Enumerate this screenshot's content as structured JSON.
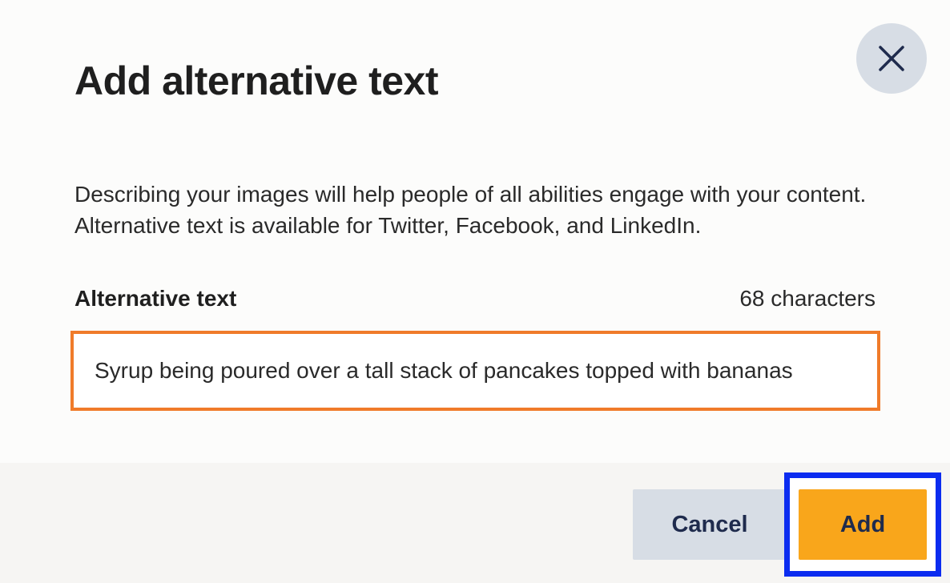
{
  "dialog": {
    "title": "Add alternative text",
    "description": "Describing your images will help people of all abilities engage with your content. Alternative text is available for Twitter, Facebook, and LinkedIn.",
    "close_icon": "close-icon"
  },
  "field": {
    "label": "Alternative text",
    "char_count": "68 characters",
    "value": "Syrup being poured over a tall stack of pancakes topped with bananas"
  },
  "buttons": {
    "cancel_label": "Cancel",
    "add_label": "Add"
  },
  "colors": {
    "input_border": "#f07b2a",
    "add_button": "#f9a61b",
    "focus_ring": "#0b2cf0",
    "button_text": "#1f2b4d",
    "secondary_button": "#d7dde5"
  }
}
